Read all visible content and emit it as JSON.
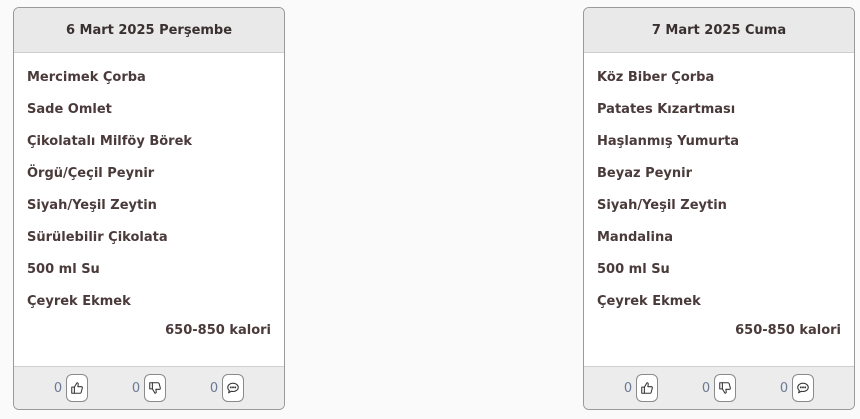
{
  "cards": [
    {
      "date": "6 Mart 2025 Perşembe",
      "items": [
        "Mercimek Çorba",
        "Sade Omlet",
        "Çikolatalı Milföy Börek",
        "Örgü/Çeçil Peynir",
        "Siyah/Yeşil Zeytin",
        "Sürülebilir Çikolata",
        "500 ml Su",
        "Çeyrek Ekmek"
      ],
      "calories": "650-850 kalori",
      "likes": "0",
      "dislikes": "0",
      "comments": "0"
    },
    {
      "date": "7 Mart 2025 Cuma",
      "items": [
        "Köz Biber Çorba",
        "Patates Kızartması",
        "Haşlanmış Yumurta",
        "Beyaz Peynir",
        "Siyah/Yeşil Zeytin",
        "Mandalina",
        "500 ml Su",
        "Çeyrek Ekmek"
      ],
      "calories": "650-850 kalori",
      "likes": "0",
      "dislikes": "0",
      "comments": "0"
    }
  ],
  "icons": {
    "like": "thumbs-up-icon",
    "dislike": "thumbs-down-icon",
    "comment": "comment-icon"
  }
}
